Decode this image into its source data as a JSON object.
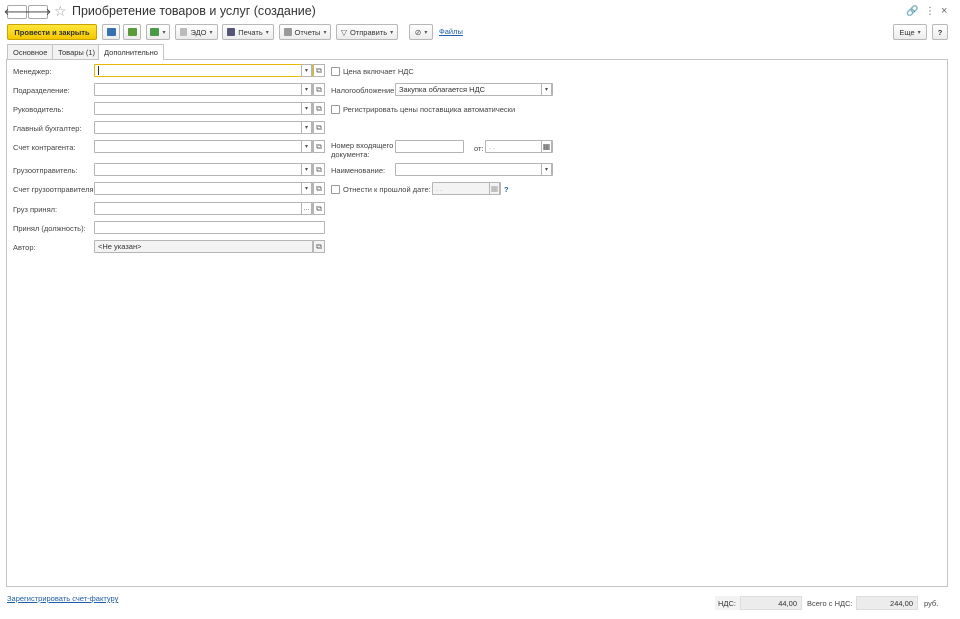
{
  "window": {
    "title": "Приобретение товаров и услуг (создание)",
    "back_glyph": "🡐",
    "forward_glyph": "🡒",
    "star_glyph": "☆",
    "link_glyph": "🔗",
    "more_glyph": "⋮",
    "close_glyph": "×"
  },
  "toolbar": {
    "post_close": "Провести и закрыть",
    "edo": "ЭДО",
    "print": "Печать",
    "reports": "Отчеты",
    "send": "Отправить",
    "files": "Файлы",
    "more": "Еще",
    "help": "?",
    "caret": "▾"
  },
  "tabs": [
    {
      "label": "Основное"
    },
    {
      "label": "Товары (1)"
    },
    {
      "label": "Дополнительно"
    }
  ],
  "form": {
    "manager_label": "Менеджер:",
    "department_label": "Подразделение:",
    "head_label": "Руководитель:",
    "accountant_label": "Главный бухгалтер:",
    "counterparty_account_label": "Счет контрагента:",
    "shipper_label": "Грузоотправитель:",
    "shipper_account_label": "Счет грузоотправителя:",
    "cargo_received_label": "Груз принял:",
    "received_position_label": "Принял (должность):",
    "author_label": "Автор:",
    "author_value": "<Не указан>",
    "price_includes_vat_label": "Цена включает НДС",
    "taxation_label": "Налогообложение:",
    "taxation_value": "Закупка облагается НДС",
    "register_prices_label": "Регистрировать цены поставщика автоматически",
    "incoming_doc_number_label": "Номер входящего документа:",
    "from_label": "от:",
    "date_placeholder": ". .",
    "name_label": "Наименование:",
    "past_date_label": "Отнести к прошлой дате:",
    "past_date_placeholder": ". .",
    "help_q": "?",
    "ellipsis": "...",
    "open_glyph": "⧉",
    "calendar_glyph": "▦"
  },
  "footer": {
    "register_invoice": "Зарегистрировать счет-фактуру",
    "vat_label": "НДС:",
    "vat_value": "44,00",
    "total_label": "Всего с НДС:",
    "total_value": "244,00",
    "currency": "руб."
  },
  "colors": {
    "primary_button": "#f5c800",
    "link": "#1d5fa8",
    "focus_border": "#e8b900"
  }
}
